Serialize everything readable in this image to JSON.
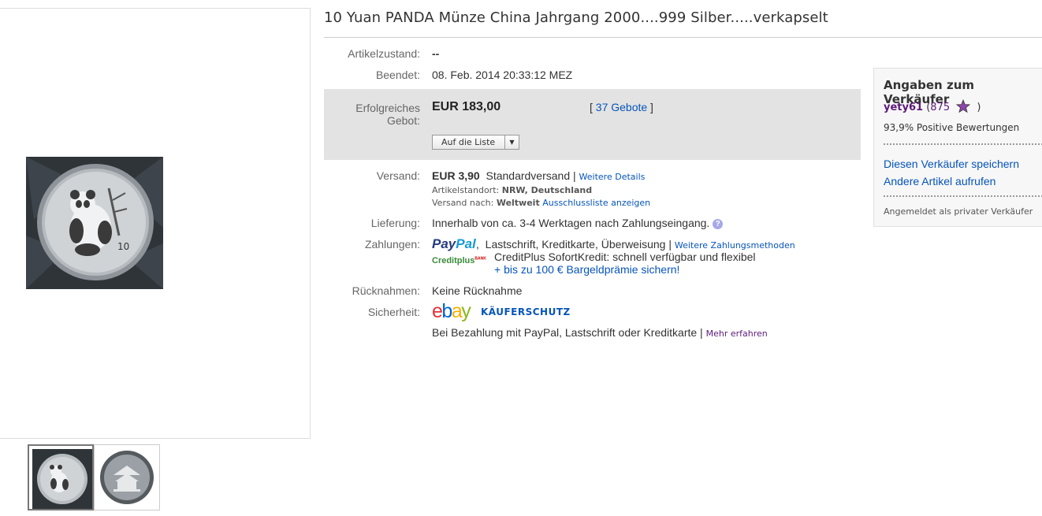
{
  "listing": {
    "title": "10 Yuan PANDA Münze China Jahrgang 2000....999 Silber.....verkapselt",
    "condition_label": "Artikelzustand:",
    "condition_value": "--",
    "ended_label": "Beendet:",
    "ended_value": "08. Feb. 2014  20:33:12 MEZ",
    "winning_bid_label": "Erfolgreiches Gebot:",
    "price": "EUR 183,00",
    "bids_link": "37 Gebote",
    "watch_button": "Auf die Liste",
    "shipping_label": "Versand:",
    "shipping_price": "EUR 3,90",
    "shipping_method": "Standardversand",
    "shipping_details_link": "Weitere Details",
    "location_label": "Artikelstandort:",
    "location_value": "NRW, Deutschland",
    "ship_to_label": "Versand nach:",
    "ship_to_value": "Weltweit",
    "exclusion_link": "Ausschlussliste anzeigen",
    "delivery_label": "Lieferung:",
    "delivery_value": "Innerhalb von ca. 3-4 Werktagen nach Zahlungseingang.",
    "payment_label": "Zahlungen:",
    "paypal_logo": "PayPal",
    "payment_methods": "Lastschrift,  Kreditkarte,  Überweisung",
    "more_payment_link": "Weitere Zahlungsmethoden",
    "creditplus_logo": "Creditplus",
    "creditplus_tag": "BANK",
    "creditplus_text": "CreditPlus SofortKredit: schnell verfügbar und flexibel",
    "creditplus_link": "+ bis zu 100 € Bargeldprämie sichern!",
    "returns_label": "Rücknahmen:",
    "returns_value": "Keine Rücknahme",
    "security_label": "Sicherheit:",
    "ebay_logo": "ebay",
    "buyer_protection": "KÄUFERSCHUTZ",
    "security_text": "Bei Bezahlung mit PayPal, Lastschrift oder Kreditkarte",
    "learn_more_link": "Mehr erfahren"
  },
  "seller": {
    "heading": "Angaben zum Verkäufer",
    "username": "yety61",
    "feedback_count": "875",
    "positive": "93,9% Positive Bewertungen",
    "save_seller_link": "Diesen Verkäufer speichern",
    "other_items_link": "Andere Artikel aufrufen",
    "private_note": "Angemeldet als privater Verkäufer"
  },
  "icons": {
    "help": "help-icon",
    "star": "star-icon",
    "dropdown": "dropdown-arrow-icon"
  },
  "colors": {
    "link": "#0654ba",
    "bid_box": "#e3e3e3",
    "star": "#8e44ad"
  }
}
